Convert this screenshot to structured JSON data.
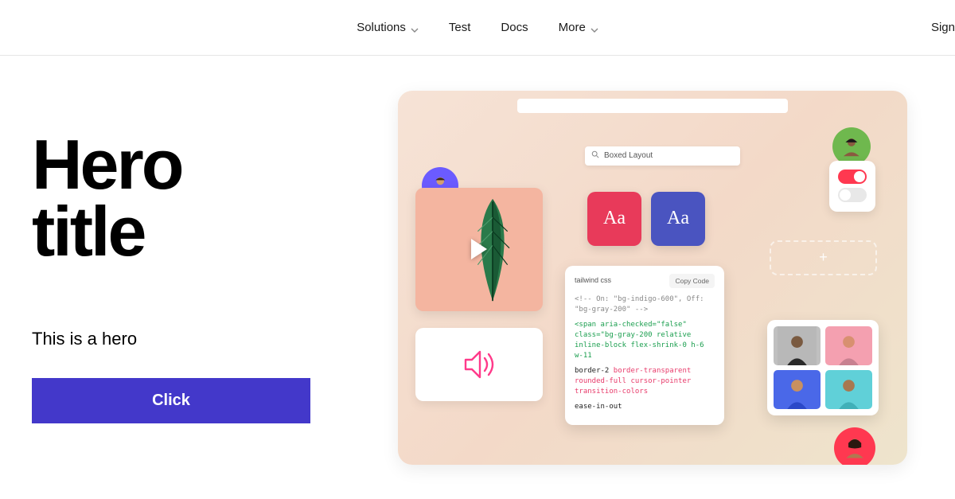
{
  "nav": {
    "items": [
      "Solutions",
      "Test",
      "Docs",
      "More"
    ],
    "signin": "Sign"
  },
  "hero": {
    "title_line1": "Hero",
    "title_line2": "title",
    "subtitle": "This is a hero",
    "cta": "Click"
  },
  "mock": {
    "search": {
      "placeholder": "Boxed Layout"
    },
    "typography": {
      "sample": "Aa"
    },
    "dashed": {
      "plus": "+"
    },
    "code": {
      "header_left": "tailwind css",
      "header_right": "Copy Code",
      "line1": "<!-- On: \"bg-indigo-600\", Off: \"bg-gray-200\" -->",
      "line2a": "<span aria-checked=\"false\" class=\"bg-gray-200 relative inline-block flex-shrink-0 h-6 w-11",
      "line3_black": "border-2 ",
      "line3_pink": "border-transparent rounded-full cursor-pointer transition-colors",
      "line4": "ease-in-out"
    }
  }
}
